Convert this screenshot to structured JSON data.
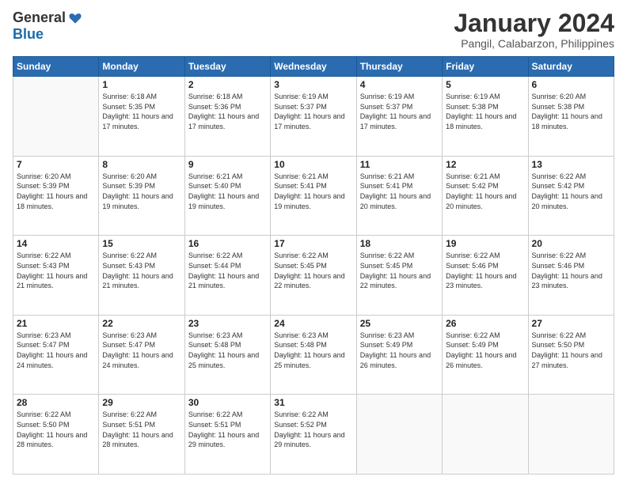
{
  "header": {
    "logo_general": "General",
    "logo_blue": "Blue",
    "month_title": "January 2024",
    "location": "Pangil, Calabarzon, Philippines"
  },
  "days_of_week": [
    "Sunday",
    "Monday",
    "Tuesday",
    "Wednesday",
    "Thursday",
    "Friday",
    "Saturday"
  ],
  "weeks": [
    [
      {
        "day": "",
        "sunrise": "",
        "sunset": "",
        "daylight": ""
      },
      {
        "day": "1",
        "sunrise": "6:18 AM",
        "sunset": "5:35 PM",
        "daylight": "11 hours and 17 minutes."
      },
      {
        "day": "2",
        "sunrise": "6:18 AM",
        "sunset": "5:36 PM",
        "daylight": "11 hours and 17 minutes."
      },
      {
        "day": "3",
        "sunrise": "6:19 AM",
        "sunset": "5:37 PM",
        "daylight": "11 hours and 17 minutes."
      },
      {
        "day": "4",
        "sunrise": "6:19 AM",
        "sunset": "5:37 PM",
        "daylight": "11 hours and 17 minutes."
      },
      {
        "day": "5",
        "sunrise": "6:19 AM",
        "sunset": "5:38 PM",
        "daylight": "11 hours and 18 minutes."
      },
      {
        "day": "6",
        "sunrise": "6:20 AM",
        "sunset": "5:38 PM",
        "daylight": "11 hours and 18 minutes."
      }
    ],
    [
      {
        "day": "7",
        "sunrise": "6:20 AM",
        "sunset": "5:39 PM",
        "daylight": "11 hours and 18 minutes."
      },
      {
        "day": "8",
        "sunrise": "6:20 AM",
        "sunset": "5:39 PM",
        "daylight": "11 hours and 19 minutes."
      },
      {
        "day": "9",
        "sunrise": "6:21 AM",
        "sunset": "5:40 PM",
        "daylight": "11 hours and 19 minutes."
      },
      {
        "day": "10",
        "sunrise": "6:21 AM",
        "sunset": "5:41 PM",
        "daylight": "11 hours and 19 minutes."
      },
      {
        "day": "11",
        "sunrise": "6:21 AM",
        "sunset": "5:41 PM",
        "daylight": "11 hours and 20 minutes."
      },
      {
        "day": "12",
        "sunrise": "6:21 AM",
        "sunset": "5:42 PM",
        "daylight": "11 hours and 20 minutes."
      },
      {
        "day": "13",
        "sunrise": "6:22 AM",
        "sunset": "5:42 PM",
        "daylight": "11 hours and 20 minutes."
      }
    ],
    [
      {
        "day": "14",
        "sunrise": "6:22 AM",
        "sunset": "5:43 PM",
        "daylight": "11 hours and 21 minutes."
      },
      {
        "day": "15",
        "sunrise": "6:22 AM",
        "sunset": "5:43 PM",
        "daylight": "11 hours and 21 minutes."
      },
      {
        "day": "16",
        "sunrise": "6:22 AM",
        "sunset": "5:44 PM",
        "daylight": "11 hours and 21 minutes."
      },
      {
        "day": "17",
        "sunrise": "6:22 AM",
        "sunset": "5:45 PM",
        "daylight": "11 hours and 22 minutes."
      },
      {
        "day": "18",
        "sunrise": "6:22 AM",
        "sunset": "5:45 PM",
        "daylight": "11 hours and 22 minutes."
      },
      {
        "day": "19",
        "sunrise": "6:22 AM",
        "sunset": "5:46 PM",
        "daylight": "11 hours and 23 minutes."
      },
      {
        "day": "20",
        "sunrise": "6:22 AM",
        "sunset": "5:46 PM",
        "daylight": "11 hours and 23 minutes."
      }
    ],
    [
      {
        "day": "21",
        "sunrise": "6:23 AM",
        "sunset": "5:47 PM",
        "daylight": "11 hours and 24 minutes."
      },
      {
        "day": "22",
        "sunrise": "6:23 AM",
        "sunset": "5:47 PM",
        "daylight": "11 hours and 24 minutes."
      },
      {
        "day": "23",
        "sunrise": "6:23 AM",
        "sunset": "5:48 PM",
        "daylight": "11 hours and 25 minutes."
      },
      {
        "day": "24",
        "sunrise": "6:23 AM",
        "sunset": "5:48 PM",
        "daylight": "11 hours and 25 minutes."
      },
      {
        "day": "25",
        "sunrise": "6:23 AM",
        "sunset": "5:49 PM",
        "daylight": "11 hours and 26 minutes."
      },
      {
        "day": "26",
        "sunrise": "6:22 AM",
        "sunset": "5:49 PM",
        "daylight": "11 hours and 26 minutes."
      },
      {
        "day": "27",
        "sunrise": "6:22 AM",
        "sunset": "5:50 PM",
        "daylight": "11 hours and 27 minutes."
      }
    ],
    [
      {
        "day": "28",
        "sunrise": "6:22 AM",
        "sunset": "5:50 PM",
        "daylight": "11 hours and 28 minutes."
      },
      {
        "day": "29",
        "sunrise": "6:22 AM",
        "sunset": "5:51 PM",
        "daylight": "11 hours and 28 minutes."
      },
      {
        "day": "30",
        "sunrise": "6:22 AM",
        "sunset": "5:51 PM",
        "daylight": "11 hours and 29 minutes."
      },
      {
        "day": "31",
        "sunrise": "6:22 AM",
        "sunset": "5:52 PM",
        "daylight": "11 hours and 29 minutes."
      },
      {
        "day": "",
        "sunrise": "",
        "sunset": "",
        "daylight": ""
      },
      {
        "day": "",
        "sunrise": "",
        "sunset": "",
        "daylight": ""
      },
      {
        "day": "",
        "sunrise": "",
        "sunset": "",
        "daylight": ""
      }
    ]
  ]
}
